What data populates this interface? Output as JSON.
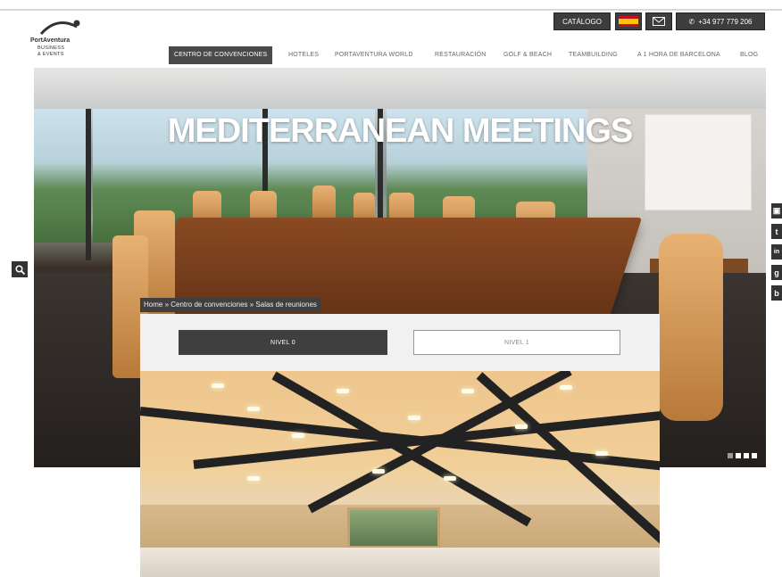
{
  "header": {
    "logo": {
      "line1": "PortAventura",
      "line2": "BUSINESS",
      "line3": "& EVENTS"
    },
    "utility": {
      "catalog_label": "CATÁLOGO",
      "language_icon": "spain-flag-icon",
      "mail_icon": "envelope-icon",
      "phone_icon": "phone-icon",
      "phone_number": "+34 977 779 206"
    },
    "nav": [
      {
        "label": "CENTRO DE CONVENCIONES",
        "active": true
      },
      {
        "label": "HOTELES"
      },
      {
        "label": "PORTAVENTURA WORLD"
      },
      {
        "label": "RESTAURACIÓN"
      },
      {
        "label": "GOLF & BEACH"
      },
      {
        "label": "TEAMBUILDING"
      },
      {
        "label": "A 1 HORA DE BARCELONA"
      },
      {
        "label": "BLOG"
      }
    ]
  },
  "hero": {
    "title": "MEDITERRANEAN MEETINGS",
    "slides_total": 4,
    "slide_current": 1
  },
  "sidebar_left": {
    "search_icon": "search-icon"
  },
  "social": [
    {
      "icon": "flickr-icon",
      "glyph": "▣"
    },
    {
      "icon": "twitter-icon",
      "glyph": "t"
    },
    {
      "icon": "linkedin-icon",
      "glyph": "in"
    },
    {
      "icon": "google-plus-icon",
      "glyph": "g"
    },
    {
      "icon": "blog-icon",
      "glyph": "b"
    }
  ],
  "breadcrumb": "Home » Centro de convenciones » Salas de reuniones",
  "tabs": [
    {
      "label": "NIVEL 0",
      "active": true
    },
    {
      "label": "NIVEL 1",
      "active": false
    }
  ],
  "colors": {
    "dark": "#3d3d3d",
    "accent": "#4a4a4a"
  }
}
